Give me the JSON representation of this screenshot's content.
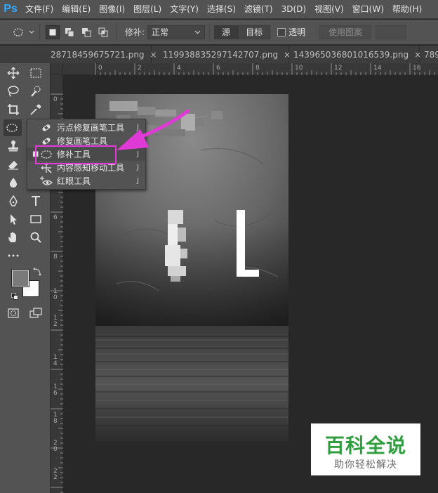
{
  "app": {
    "logo": "Ps",
    "menu": [
      "文件(F)",
      "编辑(E)",
      "图像(I)",
      "图层(L)",
      "文字(Y)",
      "选择(S)",
      "滤镜(T)",
      "3D(D)",
      "视图(V)",
      "窗口(W)",
      "帮助(H)"
    ]
  },
  "options": {
    "patch_label": "修补:",
    "patch_mode": "正常",
    "source_label": "源",
    "target_label": "目标",
    "transparent_label": "透明",
    "use_pattern_label": "使用图案"
  },
  "tabs": [
    {
      "label": "28718459675721.png",
      "close": "×"
    },
    {
      "label": "119938835297142707.png",
      "close": "×"
    },
    {
      "label": "143965036801016539.png",
      "close": "×"
    },
    {
      "label": "789"
    }
  ],
  "rulers": {
    "h": [
      "0",
      "2",
      "4",
      "6",
      "8",
      "10",
      "12",
      "14",
      "16"
    ],
    "v": [
      "0",
      "2",
      "4",
      "6",
      "8",
      "1\n0",
      "1\n2",
      "1\n4",
      "1\n6",
      "1\n8",
      "2\n0",
      "2\n2"
    ]
  },
  "flyout": {
    "items": [
      {
        "label": "污点修复画笔工具",
        "key": "J",
        "icon": "spot-healing-brush-icon",
        "selected": false
      },
      {
        "label": "修复画笔工具",
        "key": "J",
        "icon": "healing-brush-icon",
        "selected": false
      },
      {
        "label": "修补工具",
        "key": "J",
        "icon": "patch-tool-icon",
        "selected": true
      },
      {
        "label": "内容感知移动工具",
        "key": "J",
        "icon": "content-aware-move-icon",
        "selected": false
      },
      {
        "label": "红眼工具",
        "key": "J",
        "icon": "red-eye-icon",
        "selected": false
      }
    ],
    "bullet": "■"
  },
  "colors": {
    "accent": "#31a8ff",
    "highlight_box": "#e23ad8",
    "arrow": "#e03ad6",
    "watermark_green": "#2e9e3e",
    "foreground": "#7a7a7a",
    "background": "#ffffff"
  },
  "watermark": {
    "main": "百科全说",
    "sub": "助你轻松解决"
  }
}
